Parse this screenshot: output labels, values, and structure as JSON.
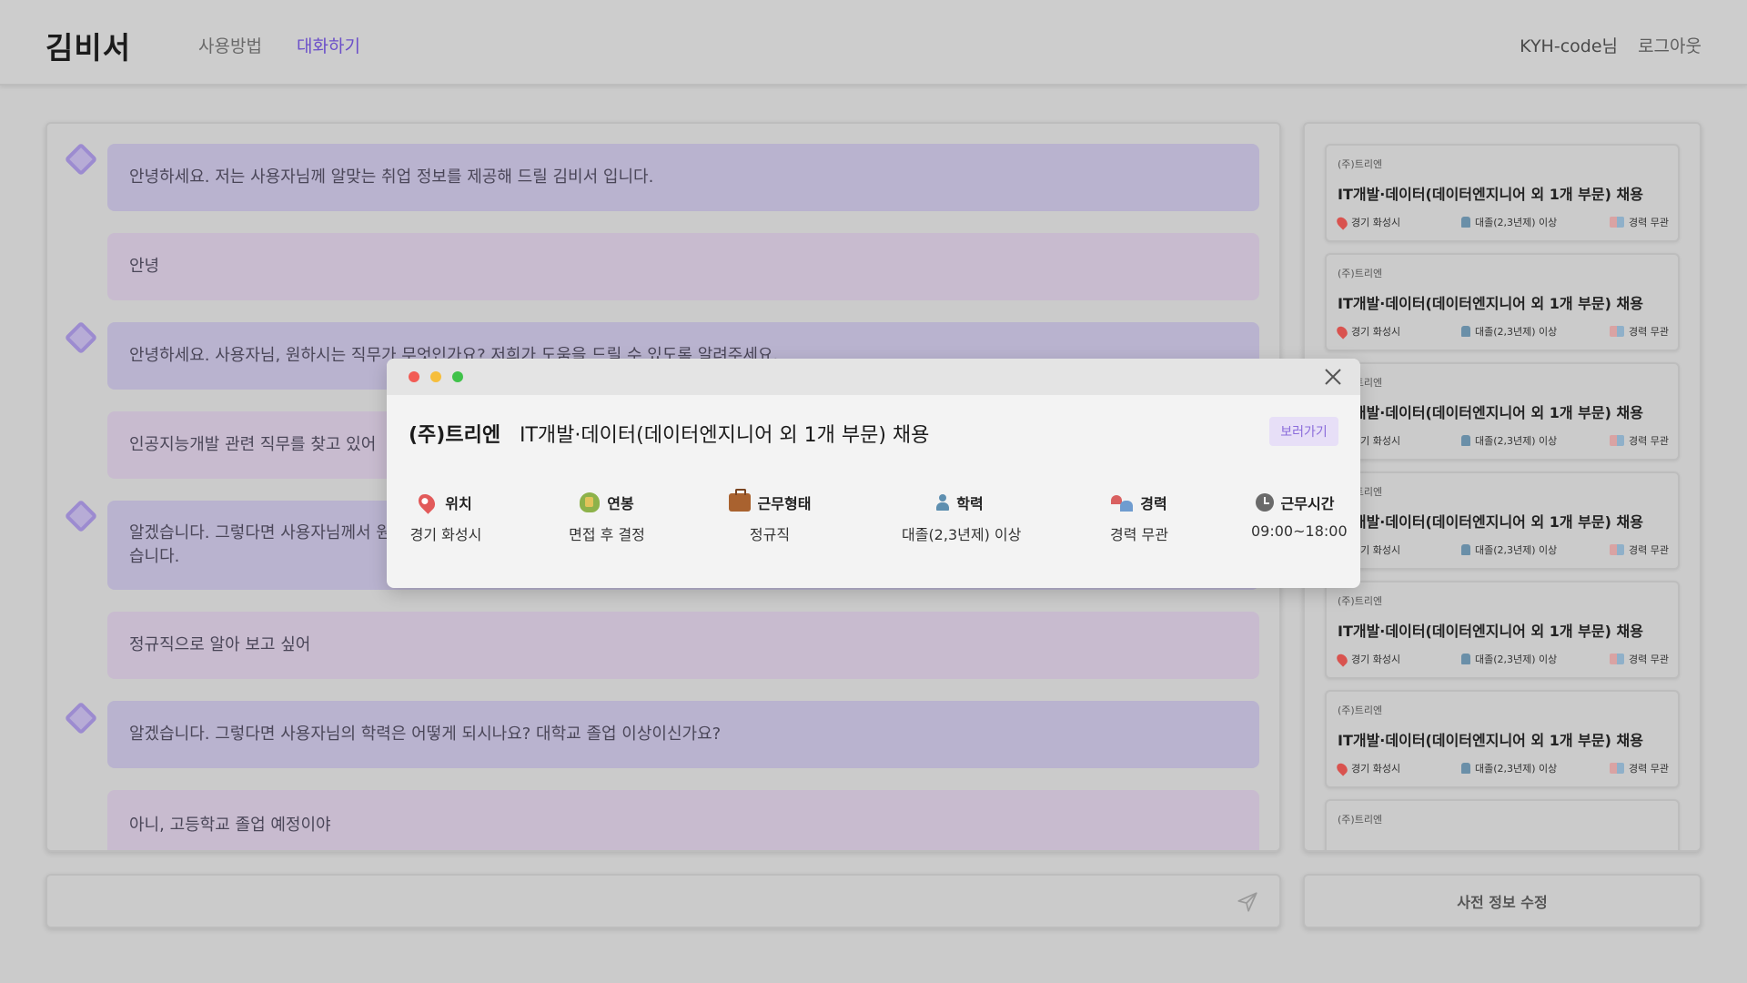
{
  "header": {
    "logo": "김비서",
    "nav": {
      "how": "사용방법",
      "chat": "대화하기"
    },
    "user": "KYH-code님",
    "logout": "로그아웃"
  },
  "chat": {
    "messages": [
      {
        "role": "bot",
        "text": "안녕하세요. 저는 사용자님께 알맞는 취업 정보를 제공해 드릴 김비서 입니다."
      },
      {
        "role": "user",
        "text": "안녕"
      },
      {
        "role": "bot",
        "text": "안녕하세요. 사용자님, 원하시는 직무가 무엇인가요? 저희가 도움을 드릴 수 있도록 알려주세요."
      },
      {
        "role": "user",
        "text": "인공지능개발 관련 직무를 찾고 있어"
      },
      {
        "role": "bot",
        "text": "알겠습니다. 그렇다면 사용자님께서 원"
      },
      {
        "role": "bot_cont",
        "text": "습니다."
      },
      {
        "role": "user",
        "text": "정규직으로 알아 보고 싶어"
      },
      {
        "role": "bot",
        "text": "알겠습니다. 그렇다면 사용자님의 학력은 어떻게 되시나요? 대학교 졸업 이상이신가요?"
      },
      {
        "role": "user",
        "text": "아니, 고등학교 졸업 예정이야"
      }
    ]
  },
  "jobs": {
    "cards": [
      {
        "company": "(주)트리엔",
        "title": "IT개발·데이터(데이터엔지니어 외 1개 부문) 채용",
        "location": "경기 화성시",
        "education": "대졸(2,3년제) 이상",
        "experience": "경력 무관"
      },
      {
        "company": "(주)트리엔",
        "title": "IT개발·데이터(데이터엔지니어 외 1개 부문) 채용",
        "location": "경기 화성시",
        "education": "대졸(2,3년제) 이상",
        "experience": "경력 무관"
      },
      {
        "company": "(주)트리엔",
        "title": "IT개발·데이터(데이터엔지니어 외 1개 부문) 채용",
        "location": "경기 화성시",
        "education": "대졸(2,3년제) 이상",
        "experience": "경력 무관"
      },
      {
        "company": "(주)트리엔",
        "title": "IT개발·데이터(데이터엔지니어 외 1개 부문) 채용",
        "location": "경기 화성시",
        "education": "대졸(2,3년제) 이상",
        "experience": "경력 무관"
      },
      {
        "company": "(주)트리엔",
        "title": "IT개발·데이터(데이터엔지니어 외 1개 부문) 채용",
        "location": "경기 화성시",
        "education": "대졸(2,3년제) 이상",
        "experience": "경력 무관"
      },
      {
        "company": "(주)트리엔",
        "title": "IT개발·데이터(데이터엔지니어 외 1개 부문) 채용",
        "location": "경기 화성시",
        "education": "대졸(2,3년제) 이상",
        "experience": "경력 무관"
      },
      {
        "company": "(주)트리엔"
      }
    ]
  },
  "edit_button": "사전 정보 수정",
  "modal": {
    "company": "(주)트리엔",
    "title": "IT개발·데이터(데이터엔지니어 외 1개 부문) 채용",
    "view_label": "보러가기",
    "info": {
      "location": {
        "label": "위치",
        "value": "경기 화성시"
      },
      "salary": {
        "label": "연봉",
        "value": "면접 후 결정"
      },
      "type": {
        "label": "근무형태",
        "value": "정규직"
      },
      "education": {
        "label": "학력",
        "value": "대졸(2,3년제) 이상"
      },
      "experience": {
        "label": "경력",
        "value": "경력 무관"
      },
      "hours": {
        "label": "근무시간",
        "value": "09:00~18:00"
      }
    }
  },
  "colors": {
    "accent": "#6b4fc9",
    "bot_bubble": "#b9b3cf",
    "user_bubble": "#c8bbcf"
  }
}
